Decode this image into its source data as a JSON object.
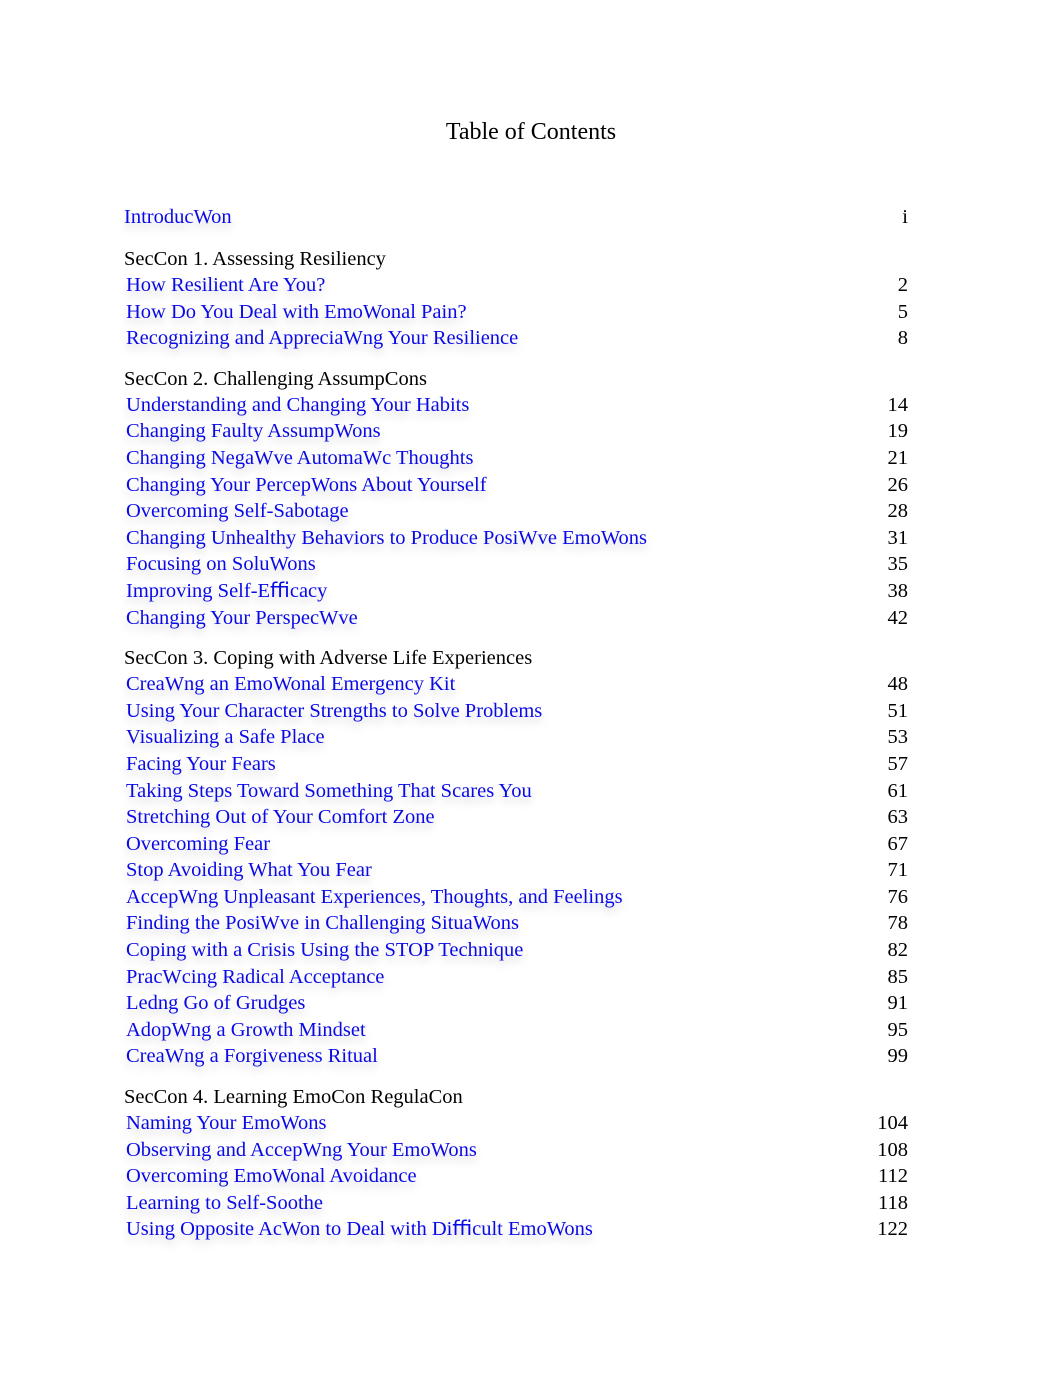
{
  "title": "Table of Contents",
  "intro": {
    "label": "IntroducWon",
    "page": "i"
  },
  "sections": [
    {
      "heading": "SecCon 1. Assessing Resiliency",
      "entries": [
        {
          "label": "How Resilient Are You?",
          "page": "2"
        },
        {
          "label": "How Do You Deal with EmoWonal Pain?",
          "page": "5"
        },
        {
          "label": "Recognizing and AppreciaWng Your Resilience",
          "page": "8"
        }
      ]
    },
    {
      "heading": "SecCon 2. Challenging AssumpCons",
      "entries": [
        {
          "label": "Understanding and Changing Your Habits",
          "page": "14"
        },
        {
          "label": "Changing Faulty AssumpWons",
          "page": "19"
        },
        {
          "label": "Changing NegaWve AutomaWc Thoughts",
          "page": "21"
        },
        {
          "label": "Changing Your PercepWons About Yourself",
          "page": "26"
        },
        {
          "label": "Overcoming Self-Sabotage",
          "page": "28"
        },
        {
          "label": "Changing Unhealthy Behaviors to Produce PosiWve EmoWons",
          "page": "31"
        },
        {
          "label": "Focusing on SoluWons",
          "page": "35"
        },
        {
          "label": "Improving Self-Eﬃcacy",
          "page": "38"
        },
        {
          "label": "Changing Your PerspecWve",
          "page": "42"
        }
      ]
    },
    {
      "heading": "SecCon 3. Coping with Adverse Life Experiences",
      "entries": [
        {
          "label": "CreaWng an EmoWonal Emergency Kit",
          "page": "48"
        },
        {
          "label": "Using Your Character Strengths to Solve Problems",
          "page": "51"
        },
        {
          "label": "Visualizing a Safe Place",
          "page": "53"
        },
        {
          "label": "Facing Your Fears",
          "page": "57"
        },
        {
          "label": "Taking Steps Toward Something That Scares You",
          "page": "61"
        },
        {
          "label": "Stretching Out of Your Comfort Zone",
          "page": "63"
        },
        {
          "label": "Overcoming Fear",
          "page": "67"
        },
        {
          "label": "Stop Avoiding What You Fear",
          "page": "71"
        },
        {
          "label": "AccepWng Unpleasant Experiences, Thoughts, and Feelings",
          "page": "76"
        },
        {
          "label": "Finding the PosiWve in Challenging SituaWons",
          "page": "78"
        },
        {
          "label": "Coping with a Crisis Using the STOP Technique",
          "page": "82"
        },
        {
          "label": "PracWcing Radical Acceptance",
          "page": "85"
        },
        {
          "label": "Ledng Go of Grudges",
          "page": "91"
        },
        {
          "label": "AdopWng a Growth Mindset",
          "page": "95"
        },
        {
          "label": "CreaWng a Forgiveness Ritual",
          "page": "99"
        }
      ]
    },
    {
      "heading": "SecCon 4. Learning EmoCon RegulaCon",
      "entries": [
        {
          "label": "Naming Your EmoWons",
          "page": "104"
        },
        {
          "label": "Observing and AccepWng Your EmoWons",
          "page": "108"
        },
        {
          "label": "Overcoming EmoWonal Avoidance",
          "page": "112"
        },
        {
          "label": "Learning to Self-Soothe",
          "page": "118"
        },
        {
          "label": "Using Opposite AcWon to Deal with Diﬃcult EmoWons",
          "page": "122"
        }
      ]
    }
  ]
}
